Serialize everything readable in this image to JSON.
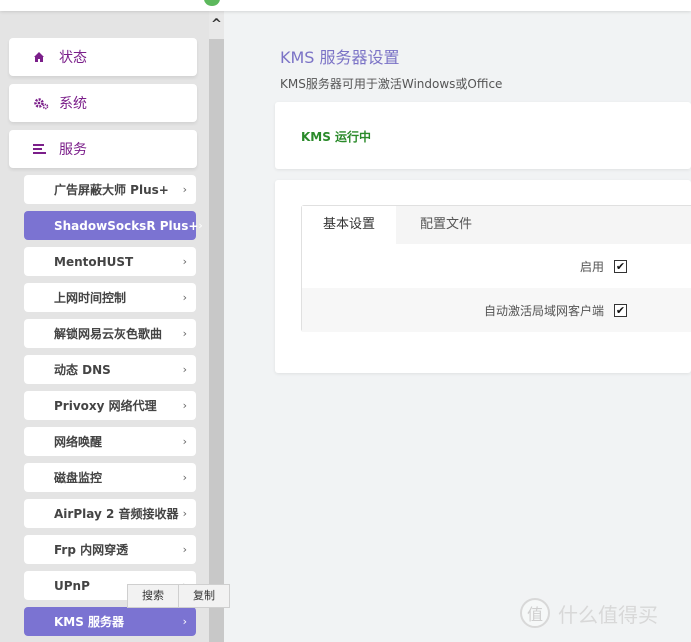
{
  "sidebar": {
    "top_items": [
      {
        "label": "状态",
        "icon": "home-icon"
      },
      {
        "label": "系统",
        "icon": "gears-icon"
      },
      {
        "label": "服务",
        "icon": "list-icon"
      }
    ],
    "sub_items": [
      {
        "label": "广告屏蔽大师 Plus+",
        "active": false
      },
      {
        "label": "ShadowSocksR Plus+",
        "active": true
      },
      {
        "label": "MentoHUST",
        "active": false
      },
      {
        "label": "上网时间控制",
        "active": false
      },
      {
        "label": "解锁网易云灰色歌曲",
        "active": false
      },
      {
        "label": "动态 DNS",
        "active": false
      },
      {
        "label": "Privoxy 网络代理",
        "active": false
      },
      {
        "label": "网络唤醒",
        "active": false
      },
      {
        "label": "磁盘监控",
        "active": false
      },
      {
        "label": "AirPlay 2 音频接收器",
        "active": false
      },
      {
        "label": "Frp 内网穿透",
        "active": false
      },
      {
        "label": "UPnP",
        "active": false
      },
      {
        "label": "KMS 服务器",
        "active": true
      }
    ],
    "chevron": "›"
  },
  "scrollbar": {
    "up_arrow": "^"
  },
  "main": {
    "title": "KMS 服务器设置",
    "description": "KMS服务器可用于激活Windows或Office",
    "status": "KMS 运行中",
    "tabs": [
      {
        "label": "基本设置",
        "active": true
      },
      {
        "label": "配置文件",
        "active": false
      }
    ],
    "options": [
      {
        "label": "启用",
        "checked": true
      },
      {
        "label": "自动激活局域网客户端",
        "checked": true
      }
    ]
  },
  "context_menu": {
    "items": [
      "搜索",
      "复制"
    ]
  },
  "watermark": {
    "badge": "值",
    "text": "什么值得买"
  },
  "colors": {
    "accent_purple": "#7b1f8a",
    "active_item": "#7b73d2",
    "title": "#7b73c6",
    "status_green": "#2a8a2a"
  }
}
